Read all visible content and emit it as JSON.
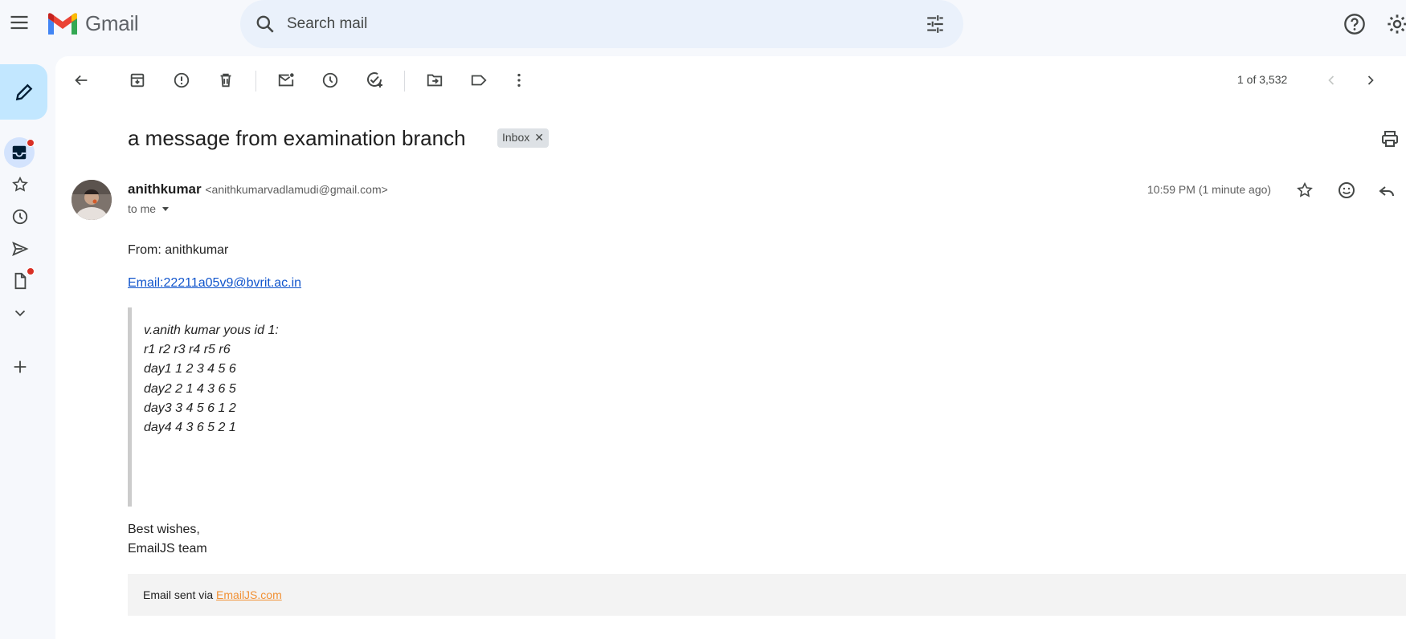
{
  "app": {
    "name": "Gmail"
  },
  "search": {
    "placeholder": "Search mail"
  },
  "toolbar": {
    "pager": "1 of 3,532"
  },
  "message": {
    "subject": "a message from examination branch",
    "label_chip": "Inbox",
    "sender_name": "anithkumar",
    "sender_email": "<anithkumarvadlamudi@gmail.com>",
    "recipient": "to me",
    "time": "10:59 PM (1 minute ago)",
    "from_line": "From: anithkumar",
    "email_link": "Email:22211a05v9@bvrit.ac.in",
    "quote_lines": [
      "v.anith kumar yous id 1:",
      "r1 r2 r3 r4 r5 r6",
      "day1 1 2 3 4 5 6",
      "day2 2 1 4 3 6 5",
      "day3 3 4 5 6 1 2",
      "day4 4 3 6 5 2 1"
    ],
    "closing_1": "Best wishes,",
    "closing_2": "EmailJS team",
    "footer_prefix": "Email sent via ",
    "footer_link": "EmailJS.com"
  },
  "colors": {
    "compose_bg": "#c2e7ff",
    "active_nav": "#d3e3fd",
    "search_bg": "#eaf1fb",
    "link": "#1155cc",
    "footer_link": "#f29134",
    "notification_dot": "#d93025"
  },
  "icons": {
    "topbar": [
      "menu-icon",
      "gmail-logo",
      "search-icon",
      "tune-icon",
      "help-icon",
      "settings-icon"
    ],
    "rail": [
      "pencil-icon",
      "inbox-icon",
      "star-icon",
      "clock-icon",
      "send-icon",
      "file-icon",
      "chevron-down-icon",
      "plus-icon"
    ],
    "toolbar": [
      "back-arrow-icon",
      "archive-icon",
      "report-spam-icon",
      "delete-icon",
      "mark-unread-icon",
      "snooze-icon",
      "add-task-icon",
      "move-to-icon",
      "label-icon",
      "more-vert-icon",
      "chevron-left-icon",
      "chevron-right-icon"
    ]
  }
}
